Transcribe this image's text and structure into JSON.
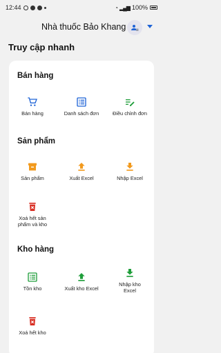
{
  "status_bar": {
    "time": "12:44",
    "battery": "100%"
  },
  "header": {
    "title": "Nhà thuốc Bảo Khang"
  },
  "page_title": "Truy cập nhanh",
  "sections": {
    "ban_hang": {
      "title": "Bán hàng",
      "items": [
        "Bán hàng",
        "Danh sách đơn",
        "Điều chỉnh đơn"
      ]
    },
    "san_pham": {
      "title": "Sản phẩm",
      "items": [
        "Sản phẩm",
        "Xuất Excel",
        "Nhập Excel",
        "Xoá hết sản phẩm và kho"
      ]
    },
    "kho_hang": {
      "title": "Kho hàng",
      "items": [
        "Tồn kho",
        "Xuất kho Excel",
        "Nhập kho Excel",
        "Xoá hết kho"
      ]
    }
  },
  "colors": {
    "blue": "#1e63d6",
    "green": "#1f9e3a",
    "orange": "#f29a1e",
    "red": "#d93025"
  },
  "icons": [
    "cart-icon",
    "list-icon",
    "edit-note-icon",
    "box-icon",
    "upload-icon",
    "download-icon",
    "delete-icon"
  ]
}
